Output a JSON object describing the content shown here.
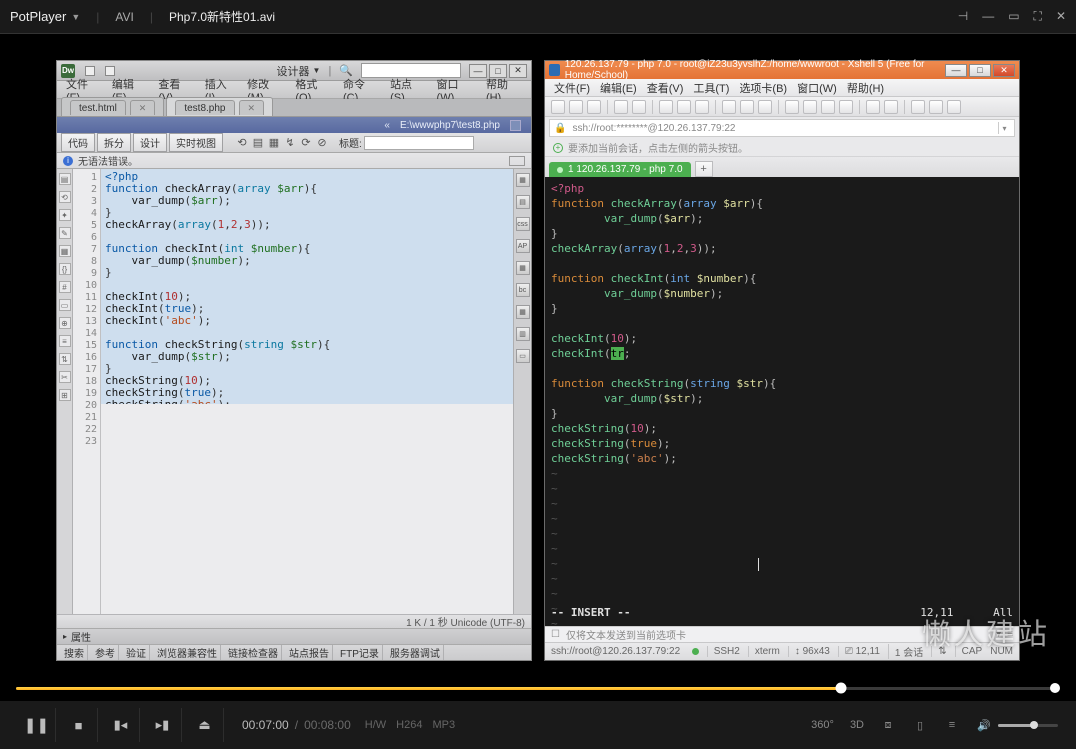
{
  "player": {
    "appName": "PotPlayer",
    "badgeFormat": "AVI",
    "currentFile": "Php7.0新特性01.avi",
    "currentTime": "00:07:00",
    "totalTime": "00:08:00",
    "hw": "H/W",
    "vcodec": "H264",
    "acodec": "MP3",
    "threeSixty": "360°",
    "threeD": "3D",
    "watermark": "懒人建站"
  },
  "dw": {
    "designerLabel": "设计器",
    "menu": [
      "文件(F)",
      "编辑(E)",
      "查看(V)",
      "插入(I)",
      "修改(M)",
      "格式(O)",
      "命令(C)",
      "站点(S)",
      "窗口(W)",
      "帮助(H)"
    ],
    "tabs": {
      "t1": "test.html",
      "t2": "test8.php"
    },
    "pathbar": "E:\\wwwphp7\\test8.php",
    "viewbar": {
      "b1": "代码",
      "b2": "拆分",
      "b3": "设计",
      "b4": "实时视图",
      "title": "标题:"
    },
    "errbar": "无语法错误。",
    "code": {
      "l1": "<?php",
      "l2a": "function",
      "l2b": "checkArray",
      "l2c": "array",
      "l2d": "$arr",
      "l3a": "var_dump",
      "l3b": "$arr",
      "l5a": "checkArray",
      "l5b": "array",
      "l5c": "1",
      "l5d": "2",
      "l5e": "3",
      "l7a": "function",
      "l7b": "checkInt",
      "l7c": "int",
      "l7d": "$number",
      "l8a": "var_dump",
      "l8b": "$number",
      "l11a": "checkInt",
      "l11b": "10",
      "l12a": "checkInt",
      "l12b": "true",
      "l13a": "checkInt",
      "l13b": "'abc'",
      "l15a": "function",
      "l15b": "checkString",
      "l15c": "string",
      "l15d": "$str",
      "l16a": "var_dump",
      "l16b": "$str",
      "l18a": "checkString",
      "l18b": "10",
      "l19a": "checkString",
      "l19b": "true",
      "l20a": "checkString",
      "l20b": "'abc'"
    },
    "status": "1 K / 1 秒 Unicode (UTF-8)",
    "props": "属性",
    "bottombar": [
      "搜索",
      "参考",
      "验证",
      "浏览器兼容性",
      "链接检查器",
      "站点报告",
      "FTP记录",
      "服务器调试"
    ]
  },
  "xs": {
    "title": "120.26.137.79 - php 7.0 - root@iZ23u3yvslhZ:/home/wwwroot - Xshell 5 (Free for Home/School)",
    "menu": [
      "文件(F)",
      "编辑(E)",
      "查看(V)",
      "工具(T)",
      "选项卡(B)",
      "窗口(W)",
      "帮助(H)"
    ],
    "addr": "ssh://root:********@120.26.137.79:22",
    "hint": "要添加当前会话，点击左侧的箭头按钮。",
    "tab": "1 120.26.137.79 - php 7.0",
    "term": {
      "l1": "<?php",
      "l2a": "function",
      "l2b": "checkArray",
      "l2c": "array",
      "l2d": "$arr",
      "l3a": "var_dump",
      "l3b": "$arr",
      "l5a": "checkArray",
      "l5b": "array",
      "l5c": "1",
      "l5d": "2",
      "l5e": "3",
      "l7a": "function",
      "l7b": "checkInt",
      "l7c": "int",
      "l7d": "$number",
      "l8a": "var_dump",
      "l8b": "$number",
      "l11a": "checkInt",
      "l11b": "10",
      "l12a": "checkInt",
      "l12b": "tr",
      "l15a": "function",
      "l15b": "checkString",
      "l15c": "string",
      "l15d": "$str",
      "l16a": "var_dump",
      "l16b": "$str",
      "l18a": "checkString",
      "l18b": "10",
      "l19a": "checkString",
      "l19b": "true",
      "l20a": "checkString",
      "l20b": "'abc'"
    },
    "mode": "-- INSERT --",
    "pos": "12,11",
    "scroll": "All",
    "hint2": "仅将文本发送到当前选项卡",
    "status": {
      "conn": "ssh://root@120.26.137.79:22",
      "ssh": "SSH2",
      "xterm": "xterm",
      "size": "96x43",
      "cursor": "12,11",
      "sess": "1 会话",
      "cap": "CAP",
      "num": "NUM"
    }
  }
}
